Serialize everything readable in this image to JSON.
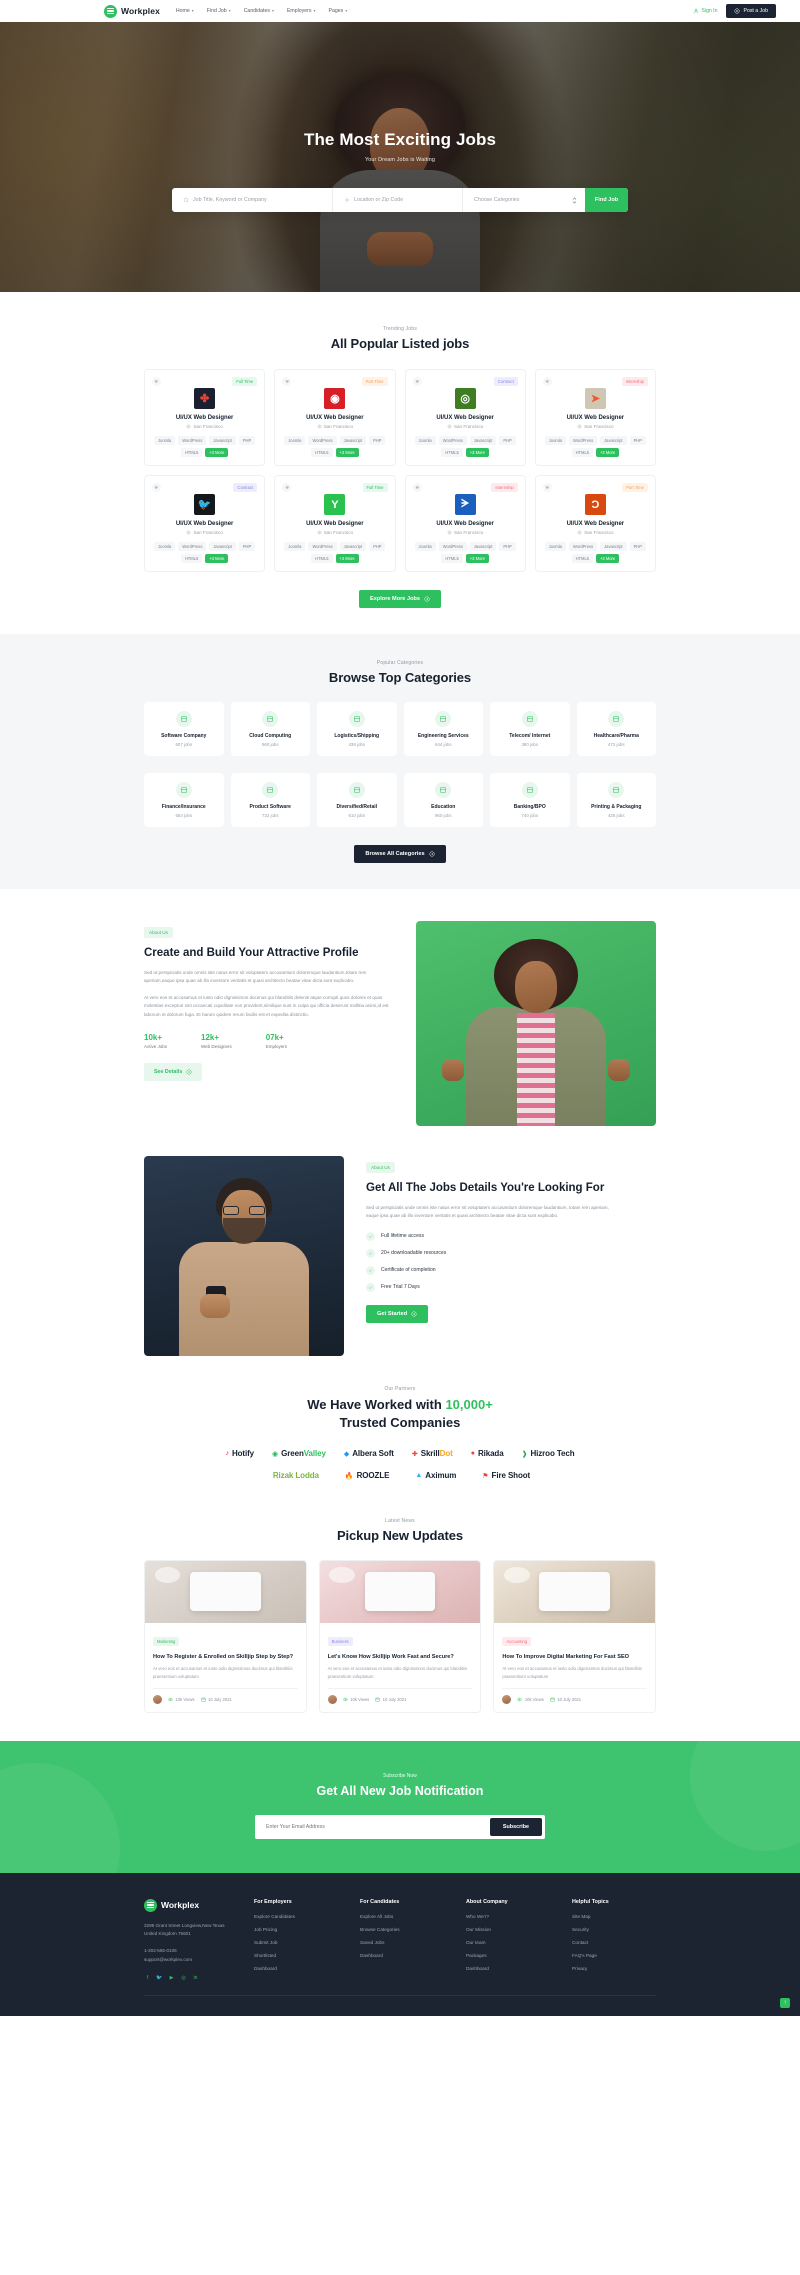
{
  "header": {
    "brand": "Workplex",
    "nav": [
      {
        "label": "Home",
        "caret": "▾"
      },
      {
        "label": "Find Job",
        "caret": "▾"
      },
      {
        "label": "Candidates",
        "caret": "▾"
      },
      {
        "label": "Employers",
        "caret": "▾"
      },
      {
        "label": "Pages",
        "caret": "▾"
      }
    ],
    "sign_in": "Sign In",
    "post_job": "Post a Job"
  },
  "hero": {
    "title": "The Most Exciting Jobs",
    "subtitle": "Your Dream Jobs is Waiting",
    "search": {
      "keyword_placeholder": "Job Title, Keyword or Company",
      "location_placeholder": "Location or Zip Code",
      "category_placeholder": "Choose Categories",
      "button": "Find Job"
    }
  },
  "jobs": {
    "eyebrow": "Trending Jobs",
    "title": "All Popular Listed jobs",
    "more_button": "Explore More Jobs",
    "cards": [
      {
        "tag": "Full Time",
        "tag_type": "full",
        "title": "UI/UX Web Designer",
        "location": "San Francisco",
        "logo_bg": "#1a2030",
        "logo_glyph": "✤",
        "logo_color": "#e8443a",
        "skills": [
          "Joomla",
          "WordPress",
          "Javascript",
          "PHP",
          "HTML5"
        ],
        "more": "+3 More"
      },
      {
        "tag": "Part Time",
        "tag_type": "part",
        "title": "UI/UX Web Designer",
        "location": "San Francisco",
        "logo_bg": "#d61f26",
        "logo_glyph": "◉",
        "logo_color": "#ffffff",
        "skills": [
          "Joomla",
          "WordPress",
          "Javascript",
          "PHP",
          "HTML5"
        ],
        "more": "+3 More"
      },
      {
        "tag": "Contract",
        "tag_type": "contract",
        "title": "UI/UX Web Designer",
        "location": "San Francisco",
        "logo_bg": "#3e7d21",
        "logo_glyph": "◎",
        "logo_color": "#ffffff",
        "skills": [
          "Joomla",
          "WordPress",
          "Javascript",
          "PHP",
          "HTML5"
        ],
        "more": "+3 More"
      },
      {
        "tag": "Internship",
        "tag_type": "intern",
        "title": "UI/UX Web Designer",
        "location": "San Francisco",
        "logo_bg": "#cfc7b4",
        "logo_glyph": "➤",
        "logo_color": "#f05a28",
        "skills": [
          "Joomla",
          "WordPress",
          "Javascript",
          "PHP",
          "HTML5"
        ],
        "more": "+3 More"
      },
      {
        "tag": "Contract",
        "tag_type": "contract",
        "title": "UI/UX Web Designer",
        "location": "San Francisco",
        "logo_bg": "#14171c",
        "logo_glyph": "🐦",
        "logo_color": "#e03a3a",
        "skills": [
          "Joomla",
          "WordPress",
          "Javascript",
          "PHP",
          "HTML5"
        ],
        "more": "+3 More"
      },
      {
        "tag": "Full Time",
        "tag_type": "full",
        "title": "UI/UX Web Designer",
        "location": "San Francisco",
        "logo_bg": "#2bc14f",
        "logo_glyph": "Y",
        "logo_color": "#ffffff",
        "skills": [
          "Joomla",
          "WordPress",
          "Javascript",
          "PHP",
          "HTML5"
        ],
        "more": "+3 More"
      },
      {
        "tag": "Internship",
        "tag_type": "intern",
        "title": "UI/UX Web Designer",
        "location": "San Francisco",
        "logo_bg": "#1a5fbd",
        "logo_glyph": "ᗒ",
        "logo_color": "#ffffff",
        "skills": [
          "Joomla",
          "WordPress",
          "Javascript",
          "PHP",
          "HTML5"
        ],
        "more": "+3 More"
      },
      {
        "tag": "Part Time",
        "tag_type": "part",
        "title": "UI/UX Web Designer",
        "location": "San Francisco",
        "logo_bg": "#d9480f",
        "logo_glyph": "Ɔ",
        "logo_color": "#ffffff",
        "skills": [
          "Joomla",
          "WordPress",
          "Javascript",
          "PHP",
          "HTML5"
        ],
        "more": "+3 More"
      }
    ]
  },
  "categories": {
    "eyebrow": "Popular Categories",
    "title": "Browse Top Categories",
    "button": "Browse All Categories",
    "items": [
      {
        "name": "Software Company",
        "jobs": "607 jobs",
        "icon": "software-icon"
      },
      {
        "name": "Cloud Computing",
        "jobs": "960 jobs",
        "icon": "cloud-icon"
      },
      {
        "name": "Logistics/Shipping",
        "jobs": "438 jobs",
        "icon": "shipping-icon"
      },
      {
        "name": "Engineering Services",
        "jobs": "644 jobs",
        "icon": "engineering-icon"
      },
      {
        "name": "Telecom/ Internet",
        "jobs": "380 jobs",
        "icon": "telecom-icon"
      },
      {
        "name": "Healthcare/Pharma",
        "jobs": "472 jobs",
        "icon": "healthcare-icon"
      },
      {
        "name": "Finance/Insurance",
        "jobs": "654 jobs",
        "icon": "finance-icon"
      },
      {
        "name": "Product Software",
        "jobs": "732 jobs",
        "icon": "product-icon"
      },
      {
        "name": "Diversified/Retail",
        "jobs": "610 jobs",
        "icon": "retail-icon"
      },
      {
        "name": "Education",
        "jobs": "960 jobs",
        "icon": "education-icon"
      },
      {
        "name": "Banking/BPO",
        "jobs": "740 jobs",
        "icon": "banking-icon"
      },
      {
        "name": "Printing & Packaging",
        "jobs": "425 jobs",
        "icon": "printing-icon"
      }
    ]
  },
  "about": {
    "pill": "About Us",
    "title": "Create and Build Your Attractive Profile",
    "p1": "Sed ut perspiciatis unde omnis iste natus error sit voluptatem accusantium doloremque laudantium,totam rem aperiam,eaque ipsa quae ab illo inventore veritatis et quasi architecto beatae vitae dicta sunt explicabo.",
    "p2": "At vero eos et accusamus et iusto odio dignissimos ducimus qui blanditiis deleniti atque corrupti quos dolores et quas molestias excepturi sint occaecati cupiditate non provident,similique sunt in culpa qui officia deserunt mollitia animi,id est laborum et dolorum fuga. Et harum quidem rerum facilis est et expedita distinctio.",
    "stats": [
      {
        "num": "10k+",
        "label": "Active Jobs"
      },
      {
        "num": "12k+",
        "label": "Web Designers"
      },
      {
        "num": "07k+",
        "label": "Employers"
      }
    ],
    "button": "See Details"
  },
  "about2": {
    "pill": "About Us",
    "title": "Get All The Jobs Details You're Looking For",
    "p1": "Sed ut perspiciatis unde omnis iste natus error sit voluptatem accusantium doloremque laudantium, totam rem aperiam, eaque ipsa quae ab illo inventore veritatis et quasi architecto beatae vitae dicta sunt explicabo.",
    "checks": [
      "Full lifetime access",
      "20+ downloadable resources",
      "Certificate of completion",
      "Free Trial 7 Days"
    ],
    "button": "Get Started"
  },
  "partners": {
    "eyebrow": "Our Partners",
    "title_a": "We Have Worked with ",
    "title_hl": "10,000+",
    "title_b": "Trusted Companies",
    "row1": [
      {
        "name": "Hotify",
        "color": "#16202e",
        "mark": "♪",
        "mark_color": "#ff0050"
      },
      {
        "name": "GreenValley",
        "color": "#16202e",
        "mark": "◉",
        "mark_color": "#1db954",
        "split": "Valley",
        "split_color": "#2ec05f"
      },
      {
        "name": "Albera Soft",
        "color": "#16202e",
        "mark": "◆",
        "mark_color": "#2196f3"
      },
      {
        "name": "SkrillDot",
        "color": "#16202e",
        "mark": "✚",
        "mark_color": "#e8443a",
        "split": "Dot",
        "split_color": "#f5a623"
      },
      {
        "name": "Rikada",
        "color": "#16202e",
        "mark": "●",
        "mark_color": "#e8443a"
      },
      {
        "name": "Hizroo Tech",
        "color": "#16202e",
        "mark": "❱",
        "mark_color": "#2e9e4f"
      }
    ],
    "row2": [
      {
        "name": "Rizak Lodda",
        "color": "#7cb342",
        "mark": "",
        "mark_color": "#7cb342"
      },
      {
        "name": "ROOZLE",
        "color": "#16202e",
        "mark": "🔥",
        "mark_color": "#ff7043"
      },
      {
        "name": "Aximum",
        "color": "#16202e",
        "mark": "▲",
        "mark_color": "#29b6f6"
      },
      {
        "name": "Fire Shoot",
        "color": "#16202e",
        "mark": "⚑",
        "mark_color": "#e8443a"
      }
    ]
  },
  "news": {
    "eyebrow": "Latest News",
    "title": "Pickup New Updates",
    "cards": [
      {
        "cat": "Marketing",
        "cat_type": "marketing",
        "title": "How To Register & Enrolled on Skilljip Step by Step?",
        "excerpt": "At vero eos et accusamus et iusto odio dignissimos ducimus qui blanditiis praesentium voluptatum",
        "views": "10k Views",
        "date": "10 July 2021"
      },
      {
        "cat": "Business",
        "cat_type": "business",
        "title": "Let's Know How Skilljip Work Fast and Secure?",
        "excerpt": "At vero eos et accusamus et iusto odio dignissimos ducimus qui blanditiis praesentium voluptatum",
        "views": "10k Views",
        "date": "10 July 2021"
      },
      {
        "cat": "Accounting",
        "cat_type": "accounting",
        "title": "How To Improve Digital Marketing For Fast SEO",
        "excerpt": "At vero eos et accusamus et iusto odio dignissimos ducimus qui blanditiis praesentium voluptatum",
        "views": "10k Views",
        "date": "10 July 2021"
      }
    ]
  },
  "subscribe": {
    "eyebrow": "Subscribe Now",
    "title": "Get All New Job Notification",
    "placeholder": "Enter Your Email Address",
    "button": "Subscribe"
  },
  "footer": {
    "brand": "Workplex",
    "address": "3298 Grant Street Longview,New Texas United Kingdom 75601",
    "phone": "1-202-555-0106",
    "email": "support@workplex.com",
    "socials": [
      "f",
      "🐦",
      "▶",
      "◎",
      "in"
    ],
    "columns": [
      {
        "title": "For Employers",
        "links": [
          "Explore Candidates",
          "Job Pricing",
          "Submit Job",
          "Shortlisted",
          "Dashboard"
        ]
      },
      {
        "title": "For Candidates",
        "links": [
          "Explore All Jobs",
          "Browse Categories",
          "Saved Jobs",
          "Dashboard"
        ]
      },
      {
        "title": "About Company",
        "links": [
          "Who We'r?",
          "Our Mission",
          "Our team",
          "Packages",
          "Dashboard"
        ]
      },
      {
        "title": "Helpful Topics",
        "links": [
          "Site Map",
          "Security",
          "Contact",
          "FAQ's Page",
          "Privacy"
        ]
      }
    ],
    "scroll_top": "↑"
  },
  "colors": {
    "accent": "#2ec05f",
    "dark": "#1c2434",
    "muted": "#9aa0a8"
  }
}
